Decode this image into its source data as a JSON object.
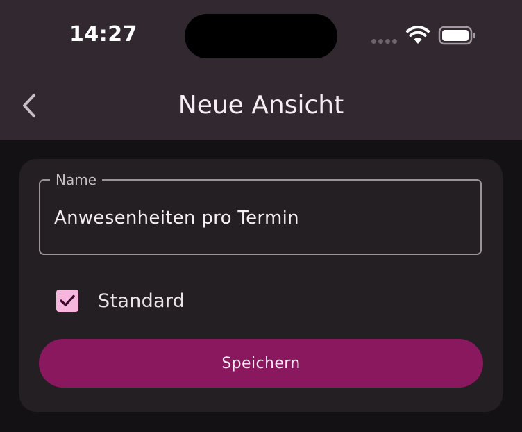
{
  "status_bar": {
    "time": "14:27"
  },
  "header": {
    "title": "Neue Ansicht",
    "back_icon": "chevron-left-icon"
  },
  "form": {
    "name_label": "Name",
    "name_value": "Anwesenheiten pro Termin",
    "checkbox_label": "Standard",
    "checkbox_checked": true,
    "save_label": "Speichern"
  },
  "colors": {
    "header_bg": "#322830",
    "page_bg": "#141114",
    "card_bg": "#231F22",
    "checkbox_fill": "#F7B6DE",
    "button_bg": "#8A185F",
    "outline": "#9C939A"
  }
}
